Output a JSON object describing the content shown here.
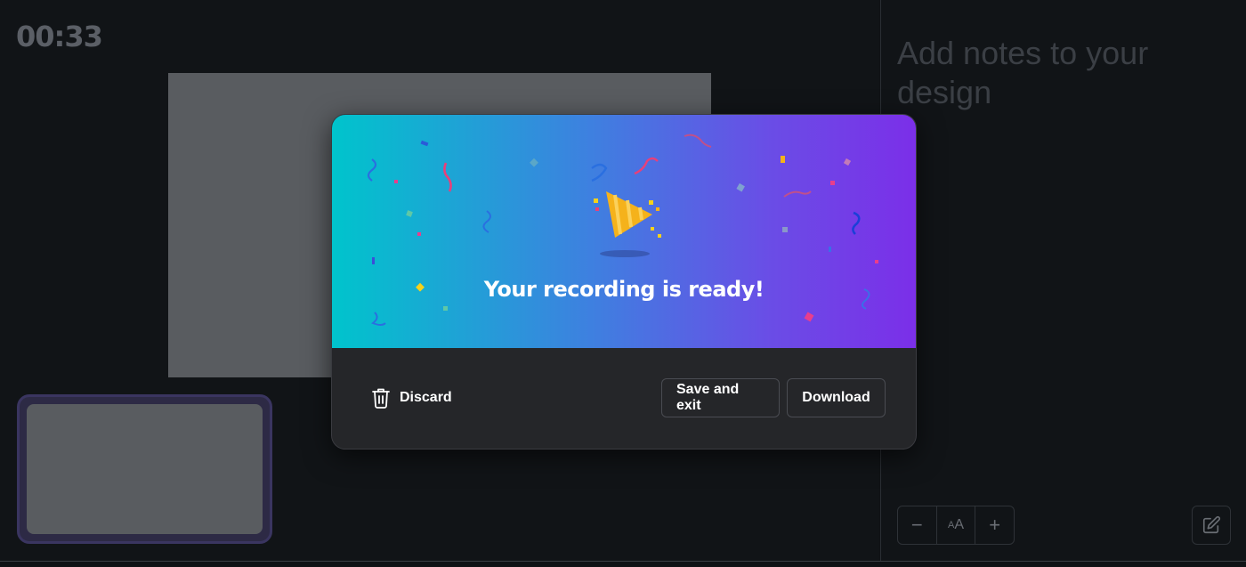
{
  "recorder": {
    "timer": "00:33"
  },
  "notes": {
    "placeholder": "Add notes to your design"
  },
  "font_controls": {
    "decrease": "−",
    "size_small": "A",
    "size_large": "A",
    "increase": "+"
  },
  "modal": {
    "title": "Your recording is ready!",
    "discard_label": "Discard",
    "save_label": "Save and exit",
    "download_label": "Download"
  },
  "colors": {
    "gradient_start": "#00c4cc",
    "gradient_end": "#7b2fe8",
    "background": "#111417",
    "slide": "#595c60"
  },
  "icons": {
    "discard": "trash-icon",
    "celebration": "party-popper-icon",
    "edit": "pencil-edit-icon"
  }
}
